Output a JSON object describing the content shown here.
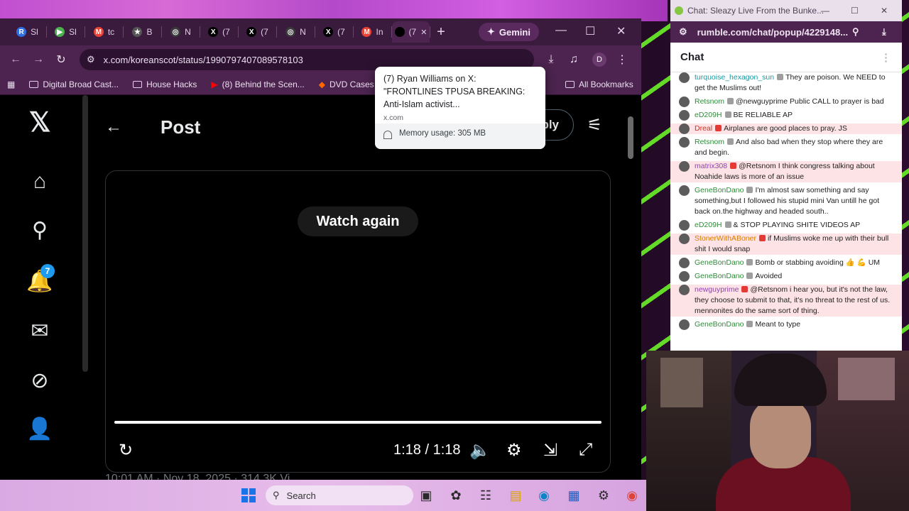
{
  "browser": {
    "tabs": [
      {
        "label": "Sl",
        "fav_color": "#2f6fe0",
        "fav": "R"
      },
      {
        "label": "Sl",
        "fav_color": "#4caf50",
        "fav": "▶"
      },
      {
        "label": "tc",
        "fav_color": "#ea4335",
        "fav": "M"
      },
      {
        "label": "B",
        "fav_color": "#555",
        "fav": "★"
      },
      {
        "label": "N",
        "fav_color": "#3a3a3a",
        "fav": "◎"
      },
      {
        "label": "(7",
        "fav_color": "#000",
        "fav": "X"
      },
      {
        "label": "(7",
        "fav_color": "#000",
        "fav": "X"
      },
      {
        "label": "N",
        "fav_color": "#3a3a3a",
        "fav": "◎"
      },
      {
        "label": "(7",
        "fav_color": "#000",
        "fav": "X"
      },
      {
        "label": "In",
        "fav_color": "#ea4335",
        "fav": "M"
      },
      {
        "label": "(7",
        "fav_color": "#000",
        "fav": ""
      }
    ],
    "gemini_label": "Gemini",
    "url": "x.com/koreanscot/status/1990797407089578103",
    "profile_initial": "D",
    "bookmarks": [
      {
        "label": "Digital Broad Cast..."
      },
      {
        "label": "House Hacks"
      },
      {
        "label": "(8) Behind the Scen..."
      },
      {
        "label": "DVD Cases -"
      }
    ],
    "all_bookmarks": "All Bookmarks"
  },
  "tooltip": {
    "title": "(7) Ryan Williams on X: \"FRONTLINES TPUSA BREAKING: Anti-Islam activist...",
    "domain": "x.com",
    "memory": "Memory usage: 305 MB"
  },
  "twitter": {
    "page_title": "Post",
    "reply_label": "ply",
    "notification_count": "7",
    "watch_again": "Watch again",
    "time": "1:18 / 1:18",
    "progress": 1.0,
    "timestamp": "10:01 AM · Nov 18, 2025 · 314.3K Vi"
  },
  "chat": {
    "window_title": "Chat: Sleazy Live From the Bunke...",
    "url": "rumble.com/chat/popup/4229148...",
    "header": "Chat",
    "messages": [
      {
        "user": "turquoise_hexagon_sun",
        "text": "They are poison. We NEED to get the Muslims out!",
        "color": "#1a9aa0",
        "hl": false
      },
      {
        "user": "Retsnom",
        "text": "@newguyprime Public CALL to prayer is bad",
        "color": "#2e8b3a",
        "hl": false
      },
      {
        "user": "eD209H",
        "text": "BE RELIABLE AP",
        "color": "#2e8b3a",
        "hl": false
      },
      {
        "user": "Dreal",
        "text": "Airplanes are good places to pray. JS",
        "color": "#c0392b",
        "hl": true
      },
      {
        "user": "Retsnom",
        "text": "And also bad when they stop where they are and begin.",
        "color": "#2e8b3a",
        "hl": false
      },
      {
        "user": "matrix308",
        "text": "@Retsnom I think congress talking about Noahide laws is more of an issue",
        "color": "#8e44ad",
        "hl": true
      },
      {
        "user": "GeneBonDano",
        "text": "I'm almost saw something and say something,but I followed his stupid mini Van untill he got back on.the highway and headed south..",
        "color": "#2e8b3a",
        "hl": false
      },
      {
        "user": "eD209H",
        "text": "& STOP PLAYING SHITE VIDEOS AP",
        "color": "#2e8b3a",
        "hl": false
      },
      {
        "user": "StonerWithABoner",
        "text": "if Muslims woke me up with their bull shit I would snap",
        "color": "#d67d00",
        "hl": true
      },
      {
        "user": "GeneBonDano",
        "text": "Bomb or stabbing avoiding 👍 💪 UM",
        "color": "#2e8b3a",
        "hl": false
      },
      {
        "user": "GeneBonDano",
        "text": "Avoided",
        "color": "#2e8b3a",
        "hl": false
      },
      {
        "user": "newguyprime",
        "text": "@Retsnom i hear you, but it's not the law, they choose to submit to that, it's no threat to the rest of us. mennonites do the same sort of thing.",
        "color": "#8e44ad",
        "hl": true
      },
      {
        "user": "GeneBonDano",
        "text": "Meant to type",
        "color": "#2e8b3a",
        "hl": false
      }
    ]
  },
  "taskbar": {
    "search_label": "Search"
  },
  "colors": {
    "accent_purple": "#4c244f",
    "x_blue": "#1d9bf0"
  }
}
